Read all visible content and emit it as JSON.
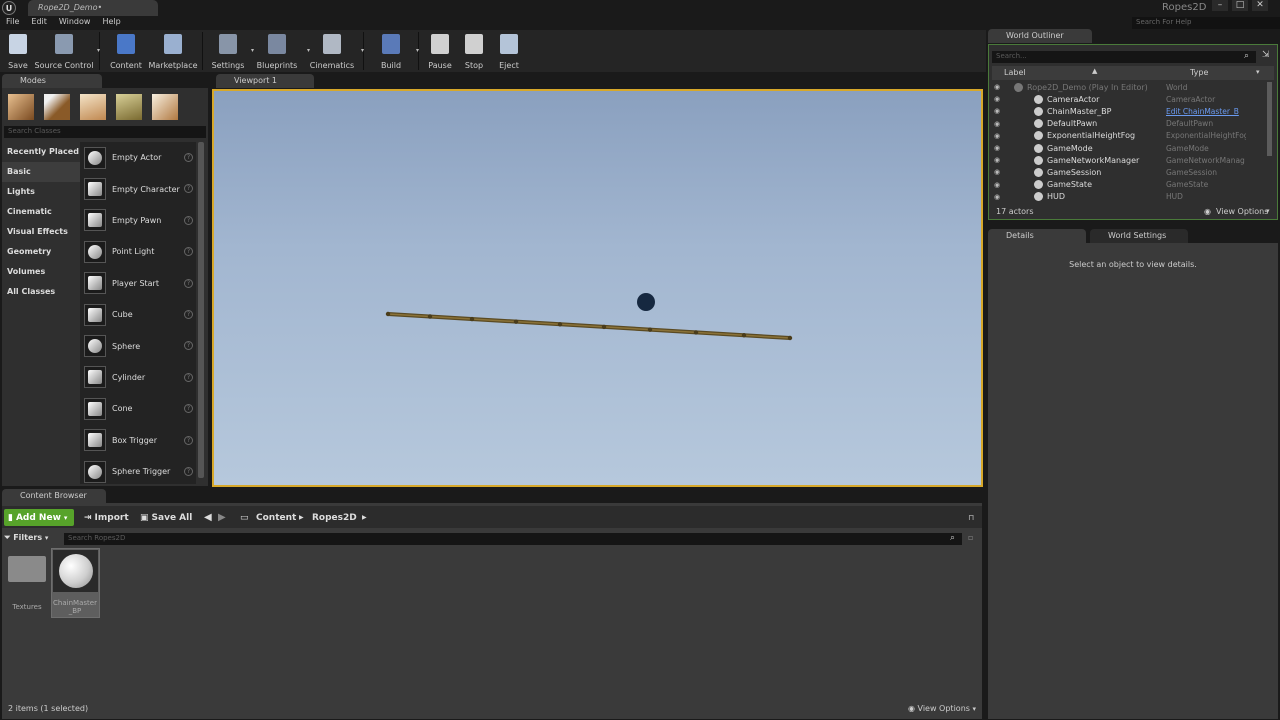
{
  "window": {
    "doc_tab": "Rope2D_Demo•",
    "project": "Ropes2D",
    "search_help": "Search For Help",
    "logo": "U"
  },
  "menu": [
    "File",
    "Edit",
    "Window",
    "Help"
  ],
  "toolbar": [
    {
      "label": "Save",
      "icon": "save-icon",
      "color": "#c8d4e4"
    },
    {
      "label": "Source Control",
      "icon": "source-control-icon",
      "color": "#8a9ab0"
    },
    {
      "label": "Content",
      "icon": "content-icon",
      "color": "#4a78c8"
    },
    {
      "label": "Marketplace",
      "icon": "marketplace-icon",
      "color": "#9ab0d0"
    },
    {
      "label": "Settings",
      "icon": "settings-icon",
      "color": "#8895a8"
    },
    {
      "label": "Blueprints",
      "icon": "blueprints-icon",
      "color": "#7a88a0"
    },
    {
      "label": "Cinematics",
      "icon": "cinematics-icon",
      "color": "#b0b8c4"
    },
    {
      "label": "Build",
      "icon": "build-icon",
      "color": "#5a7ab8"
    },
    {
      "label": "Pause",
      "icon": "pause-icon",
      "color": "#d0d0d0"
    },
    {
      "label": "Stop",
      "icon": "stop-icon",
      "color": "#d0d0d0"
    },
    {
      "label": "Eject",
      "icon": "eject-icon",
      "color": "#b4c4d8"
    }
  ],
  "modes": {
    "tab": "Modes",
    "search_placeholder": "Search Classes",
    "categories": [
      "Recently Placed",
      "Basic",
      "Lights",
      "Cinematic",
      "Visual Effects",
      "Geometry",
      "Volumes",
      "All Classes"
    ],
    "selected_category": "Basic",
    "items": [
      "Empty Actor",
      "Empty Character",
      "Empty Pawn",
      "Point Light",
      "Player Start",
      "Cube",
      "Sphere",
      "Cylinder",
      "Cone",
      "Box Trigger",
      "Sphere Trigger"
    ],
    "help_glyph": "?"
  },
  "viewport": {
    "tab": "Viewport 1"
  },
  "outliner": {
    "tab": "World Outliner",
    "search_placeholder": "Search...",
    "col_label": "Label",
    "col_type": "Type",
    "rows": [
      {
        "label": "Rope2D_Demo (Play In Editor)",
        "type": "World",
        "dim": true
      },
      {
        "label": "CameraActor",
        "type": "CameraActor"
      },
      {
        "label": "ChainMaster_BP",
        "type": "Edit ChainMaster_B",
        "link": true
      },
      {
        "label": "DefaultPawn",
        "type": "DefaultPawn"
      },
      {
        "label": "ExponentialHeightFog",
        "type": "ExponentialHeightFog"
      },
      {
        "label": "GameMode",
        "type": "GameMode"
      },
      {
        "label": "GameNetworkManager",
        "type": "GameNetworkManag"
      },
      {
        "label": "GameSession",
        "type": "GameSession"
      },
      {
        "label": "GameState",
        "type": "GameState"
      },
      {
        "label": "HUD",
        "type": "HUD"
      }
    ],
    "count": "17 actors",
    "view_options": "View Options"
  },
  "details": {
    "tab": "Details",
    "world_settings_tab": "World Settings",
    "empty_msg": "Select an object to view details."
  },
  "content_browser": {
    "tab": "Content Browser",
    "add_new": "Add New",
    "import": "Import",
    "save_all": "Save All",
    "path": [
      "Content",
      "Ropes2D"
    ],
    "filters": "Filters",
    "search_placeholder": "Search Ropes2D",
    "assets": [
      {
        "name": "Textures",
        "type": "folder"
      },
      {
        "name": "ChainMaster_BP",
        "type": "blueprint",
        "selected": true
      }
    ],
    "status": "2 items (1 selected)",
    "view_options": "View Options"
  }
}
